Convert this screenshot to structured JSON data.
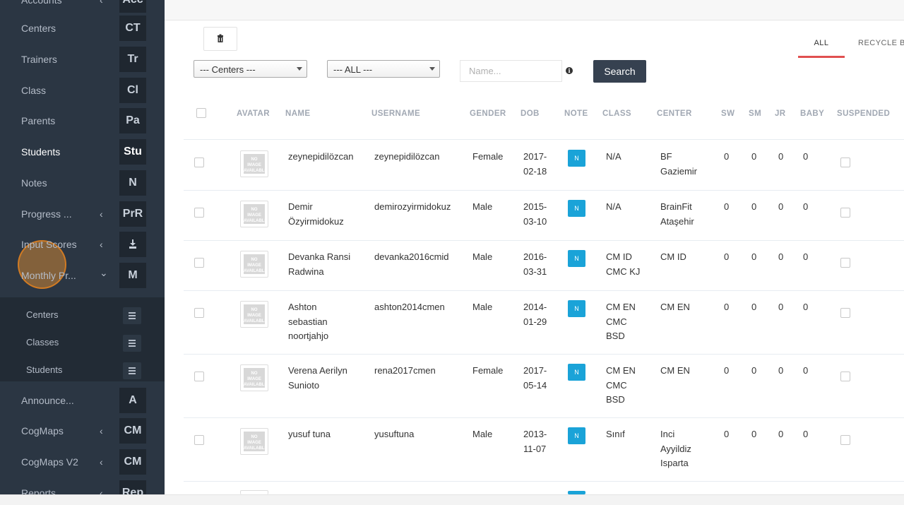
{
  "sidebar": {
    "items": [
      {
        "label": "Accounts",
        "badge": "Acc",
        "chevron": "‹",
        "active": false
      },
      {
        "label": "Centers",
        "badge": "CT",
        "chevron": "",
        "active": false
      },
      {
        "label": "Trainers",
        "badge": "Tr",
        "chevron": "",
        "active": false
      },
      {
        "label": "Class",
        "badge": "Cl",
        "chevron": "",
        "active": false
      },
      {
        "label": "Parents",
        "badge": "Pa",
        "chevron": "",
        "active": false
      },
      {
        "label": "Students",
        "badge": "Stu",
        "chevron": "",
        "active": true
      },
      {
        "label": "Notes",
        "badge": "N",
        "chevron": "",
        "active": false
      },
      {
        "label": "Progress ...",
        "badge": "PrR",
        "chevron": "‹",
        "active": false
      },
      {
        "label": "Input Scores",
        "badge": "download-icon",
        "chevron": "‹",
        "active": false
      },
      {
        "label": "Monthly Pr...",
        "badge": "M",
        "chevron": "⌄",
        "active": false
      },
      {
        "label": "Announce...",
        "badge": "A",
        "chevron": "",
        "active": false
      },
      {
        "label": "CogMaps",
        "badge": "CM",
        "chevron": "‹",
        "active": false
      },
      {
        "label": "CogMaps V2",
        "badge": "CM",
        "chevron": "‹",
        "active": false
      },
      {
        "label": "Reports",
        "badge": "Rep",
        "chevron": "‹",
        "active": false
      }
    ],
    "submenu": [
      {
        "label": "Centers",
        "icon": "list-icon"
      },
      {
        "label": "Classes",
        "icon": "list-icon"
      },
      {
        "label": "Students",
        "icon": "list-icon"
      }
    ]
  },
  "toolbar": {
    "centers_select": "--- Centers ---",
    "all_select": "--- ALL ---",
    "name_placeholder": "Name...",
    "search_label": "Search",
    "delete_icon": "trash-icon"
  },
  "tabs": [
    {
      "label": "ALL",
      "active": true
    },
    {
      "label": "RECYCLE BIN",
      "active": false
    }
  ],
  "table": {
    "columns": [
      "AVATAR",
      "NAME",
      "USERNAME",
      "GENDER",
      "DOB",
      "NOTE",
      "CLASS",
      "CENTER",
      "SW",
      "SM",
      "JR",
      "BABY",
      "SUSPENDED"
    ],
    "avatar_text": "NO IMAGE AVAILABLE",
    "note_label": "N",
    "rows": [
      {
        "name": [
          "zeynepidilözcan"
        ],
        "username": "zeynepidilözcan",
        "gender": "Female",
        "dob": [
          "2017-",
          "02-18"
        ],
        "class": [
          "N/A"
        ],
        "center": [
          "BF",
          "Gaziemir"
        ],
        "sw": "0",
        "sm": "0",
        "jr": "0",
        "baby": "0"
      },
      {
        "name": [
          "Demir",
          "Özyirmidokuz"
        ],
        "username": "demirozyirmidokuz",
        "gender": "Male",
        "dob": [
          "2015-",
          "03-10"
        ],
        "class": [
          "N/A"
        ],
        "center": [
          "BrainFit",
          "Ataşehir"
        ],
        "sw": "0",
        "sm": "0",
        "jr": "0",
        "baby": "0"
      },
      {
        "name": [
          "Devanka Ransi",
          "Radwina"
        ],
        "username": "devanka2016cmid",
        "gender": "Male",
        "dob": [
          "2016-",
          "03-31"
        ],
        "class": [
          "CM ID",
          "CMC KJ"
        ],
        "center": [
          "CM ID"
        ],
        "sw": "0",
        "sm": "0",
        "jr": "0",
        "baby": "0"
      },
      {
        "name": [
          "Ashton",
          "sebastian",
          "noortjahjo"
        ],
        "username": "ashton2014cmen",
        "gender": "Male",
        "dob": [
          "2014-",
          "01-29"
        ],
        "class": [
          "CM EN",
          "CMC",
          "BSD"
        ],
        "center": [
          "CM EN"
        ],
        "sw": "0",
        "sm": "0",
        "jr": "0",
        "baby": "0"
      },
      {
        "name": [
          "Verena Aerilyn",
          "Sunioto"
        ],
        "username": "rena2017cmen",
        "gender": "Female",
        "dob": [
          "2017-",
          "05-14"
        ],
        "class": [
          "CM EN",
          "CMC",
          "BSD"
        ],
        "center": [
          "CM EN"
        ],
        "sw": "0",
        "sm": "0",
        "jr": "0",
        "baby": "0"
      },
      {
        "name": [
          "yusuf tuna"
        ],
        "username": "yusuftuna",
        "gender": "Male",
        "dob": [
          "2013-",
          "11-07"
        ],
        "class": [
          "Sınıf"
        ],
        "center": [
          "Inci",
          "Ayyildiz",
          "Isparta"
        ],
        "sw": "0",
        "sm": "0",
        "jr": "0",
        "baby": "0"
      }
    ]
  }
}
